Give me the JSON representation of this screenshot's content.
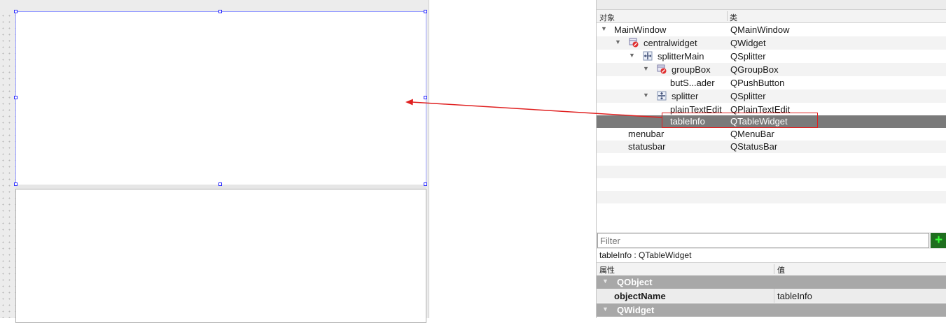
{
  "object_inspector": {
    "header": {
      "object_col": "对象",
      "class_col": "类"
    },
    "rows": [
      {
        "name": "MainWindow",
        "class": "QMainWindow",
        "expanded": true,
        "icon": "none"
      },
      {
        "name": "centralwidget",
        "class": "QWidget",
        "expanded": true,
        "icon": "widget-broken-layout-icon"
      },
      {
        "name": "splitterMain",
        "class": "QSplitter",
        "expanded": true,
        "icon": "horizontal-splitter-icon"
      },
      {
        "name": "groupBox",
        "class": "QGroupBox",
        "expanded": true,
        "icon": "widget-broken-layout-icon"
      },
      {
        "name": "butS...ader",
        "class": "QPushButton",
        "icon": "none"
      },
      {
        "name": "splitter",
        "class": "QSplitter",
        "expanded": true,
        "icon": "vertical-splitter-icon"
      },
      {
        "name": "plainTextEdit",
        "class": "QPlainTextEdit",
        "icon": "none"
      },
      {
        "name": "tableInfo",
        "class": "QTableWidget",
        "selected": true,
        "icon": "none"
      },
      {
        "name": "menubar",
        "class": "QMenuBar",
        "icon": "none"
      },
      {
        "name": "statusbar",
        "class": "QStatusBar",
        "icon": "none"
      }
    ]
  },
  "filter": {
    "placeholder": "Filter",
    "add_button": "+"
  },
  "property_editor": {
    "caption": "tableInfo : QTableWidget",
    "header": {
      "property_col": "属性",
      "value_col": "值"
    },
    "groups": [
      {
        "label": "QObject"
      },
      {
        "label": "QWidget"
      }
    ],
    "rows": [
      {
        "key": "objectName",
        "value": "tableInfo"
      }
    ]
  },
  "colors": {
    "selection": "#7a7a7a",
    "annotation_red": "#e02020",
    "handle_blue": "#2a2aff",
    "add_green": "#39ff39"
  }
}
